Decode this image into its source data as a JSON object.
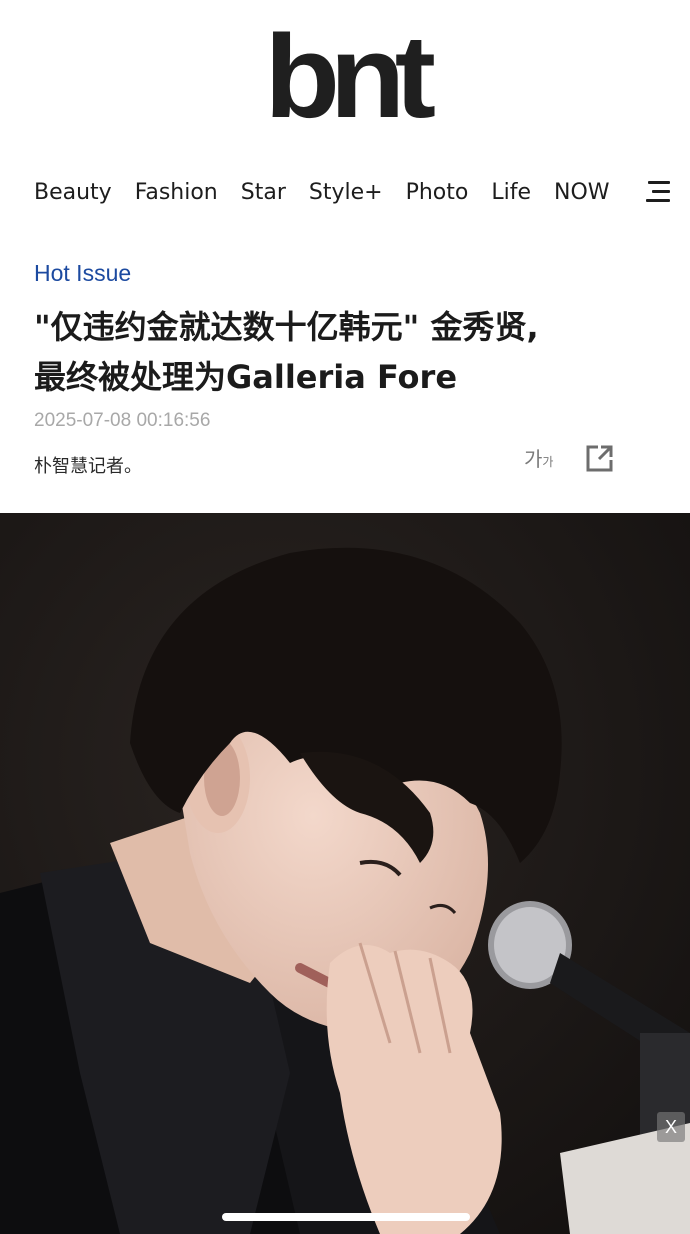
{
  "header": {
    "logo": "bnt"
  },
  "nav": {
    "items": [
      {
        "label": "Beauty"
      },
      {
        "label": "Fashion"
      },
      {
        "label": "Star"
      },
      {
        "label": "Style+"
      },
      {
        "label": "Photo"
      },
      {
        "label": "Life"
      },
      {
        "label": "NOW"
      }
    ],
    "menu_icon": "hamburger-menu-icon"
  },
  "article": {
    "category": "Hot Issue",
    "title_line1": "\"仅违约金就达数十亿韩元\" 金秀贤,",
    "title_line2": "最终被处理为Galleria Fore",
    "timestamp": "2025-07-08 00:16:56",
    "byline": "朴智慧记者。",
    "font_size_icon": {
      "big": "가",
      "small": "가"
    },
    "share_icon": "share-icon"
  },
  "photo": {
    "description_icon": "article-photo",
    "close_label": "X"
  },
  "colors": {
    "category": "#1c4aa0",
    "text": "#1b1b1b",
    "timestamp": "#a8a8a8",
    "photo_bg": "#1b1716"
  }
}
